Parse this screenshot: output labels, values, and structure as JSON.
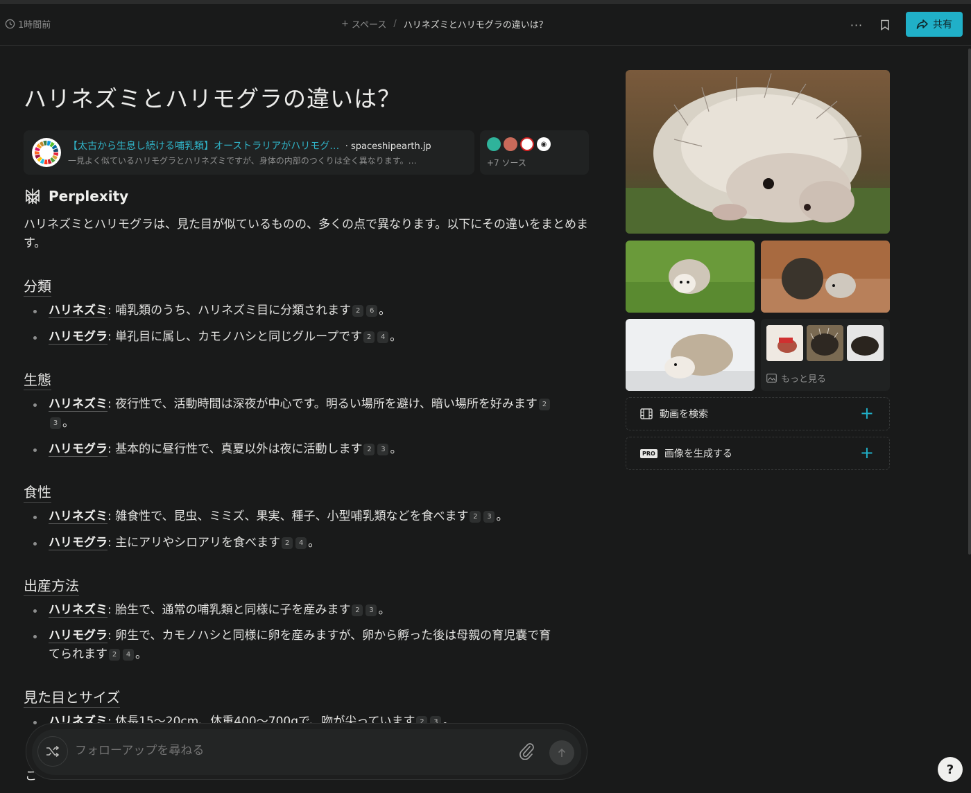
{
  "header": {
    "time": "1時間前",
    "space_label": "スペース",
    "thread_title": "ハリネズミとハリモグラの違いは？",
    "share_label": "共有"
  },
  "question": "ハリネズミとハリモグラの違いは？",
  "source": {
    "title": "【太古から生息し続ける哺乳類】オーストラリアがハリモグ…",
    "domain": "spaceshipearth.jp",
    "snippet": "一見よく似ているハリモグラとハリネズミですが、身体の内部のつくりは全く異なります。…"
  },
  "more_sources": "+7 ソース",
  "brand": "Perplexity",
  "intro": "ハリネズミとハリモグラは、見た目が似ているものの、多くの点で異なります。以下にその違いをまとめます。",
  "sections": [
    {
      "heading": "分類",
      "items": [
        {
          "term": "ハリネズミ",
          "text": ": 哺乳類のうち、ハリネズミ目に分類されます",
          "c1": "2",
          "c2": "6"
        },
        {
          "term": "ハリモグラ",
          "text": ": 単孔目に属し、カモノハシと同じグループです",
          "c1": "2",
          "c2": "4"
        }
      ]
    },
    {
      "heading": "生態",
      "items": [
        {
          "term": "ハリネズミ",
          "text": ": 夜行性で、活動時間は深夜が中心です。明るい場所を避け、暗い場所を好みます",
          "c1": "2",
          "c2": "3"
        },
        {
          "term": "ハリモグラ",
          "text": ": 基本的に昼行性で、真夏以外は夜に活動します",
          "c1": "2",
          "c2": "3"
        }
      ]
    },
    {
      "heading": "食性",
      "items": [
        {
          "term": "ハリネズミ",
          "text": ": 雑食性で、昆虫、ミミズ、果実、種子、小型哺乳類などを食べます",
          "c1": "2",
          "c2": "3"
        },
        {
          "term": "ハリモグラ",
          "text": ": 主にアリやシロアリを食べます",
          "c1": "2",
          "c2": "4"
        }
      ]
    },
    {
      "heading": "出産方法",
      "items": [
        {
          "term": "ハリネズミ",
          "text": ": 胎生で、通常の哺乳類と同様に子を産みます",
          "c1": "2",
          "c2": "3"
        },
        {
          "term": "ハリモグラ",
          "text": ": 卵生で、カモノハシと同様に卵を産みますが、卵から孵った後は母親の育児嚢で育てられます",
          "c1": "2",
          "c2": "4"
        }
      ]
    },
    {
      "heading": "見た目とサイズ",
      "items": [
        {
          "term": "ハリネズミ",
          "text": ": 体長15〜20cm、体重400〜700gで、吻が尖っています",
          "c1": "2",
          "c2": "3"
        }
      ]
    }
  ],
  "period": "。",
  "peek_text": "こ",
  "sidebar": {
    "more_images": "もっと見る",
    "search_video": "動画を検索",
    "generate_image": "画像を生成する",
    "pro_badge": "PRO"
  },
  "composer": {
    "placeholder": "フォローアップを尋ねる"
  },
  "help": "?",
  "colors": {
    "accent": "#20b0c8",
    "background": "#191a1a"
  }
}
